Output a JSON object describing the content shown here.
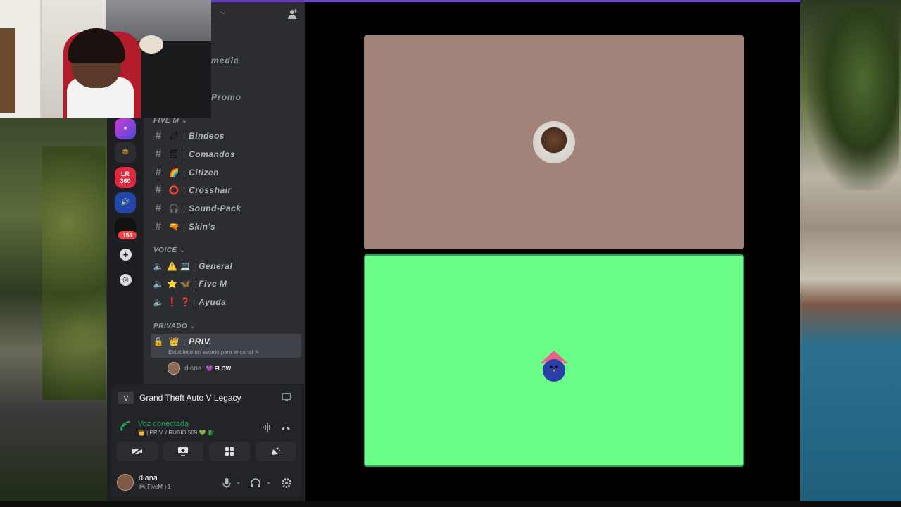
{
  "webcam": {
    "label": "streamer-webcam"
  },
  "server": {
    "top_channels": [
      "media",
      "Promo"
    ],
    "badge_count": "158",
    "categories": {
      "five_m": "FIVE M",
      "voice": "VOICE",
      "privado": "PRIVADO"
    },
    "text_channels": [
      {
        "emoji": "🖍",
        "sep": "|",
        "name": "Bindeos"
      },
      {
        "emoji": "🗒",
        "sep": "|",
        "name": "Comandos"
      },
      {
        "emoji": "🌈",
        "sep": "|",
        "name": "Citizen"
      },
      {
        "emoji": "⭕",
        "sep": "|",
        "name": "Crosshair"
      },
      {
        "emoji": "🎧",
        "sep": "|",
        "name": "Sound-Pack"
      },
      {
        "emoji": "🔫",
        "sep": "|",
        "name": "Skin's"
      }
    ],
    "voice_channels": [
      {
        "emoji": "⚠️ 💻",
        "sep": "|",
        "name": "General"
      },
      {
        "emoji": "⭐ 🦋",
        "sep": "|",
        "name": "Five M"
      },
      {
        "emoji": "❗ ❓",
        "sep": "|",
        "name": "Ayuda"
      }
    ],
    "private_channel": {
      "emoji": "👑",
      "sep": "|",
      "name": "PRIV.",
      "status_hint": "Establece un estado para el canal ✎"
    },
    "voice_user": {
      "name": "diana",
      "tag": "💜 FLOW"
    }
  },
  "activity": {
    "game": "Grand Theft Auto V Legacy"
  },
  "voice_status": {
    "title": "Voz conectada",
    "channel": "👑 | PRIV. / RUBIO 509 💚 🐉"
  },
  "user": {
    "name": "diana",
    "status": "🎮 FiveM +1"
  },
  "colors": {
    "accent": "#6d3fd1",
    "connected": "#23a55a",
    "tile_top": "#a2837a",
    "tile_bottom": "#6bff8a"
  }
}
